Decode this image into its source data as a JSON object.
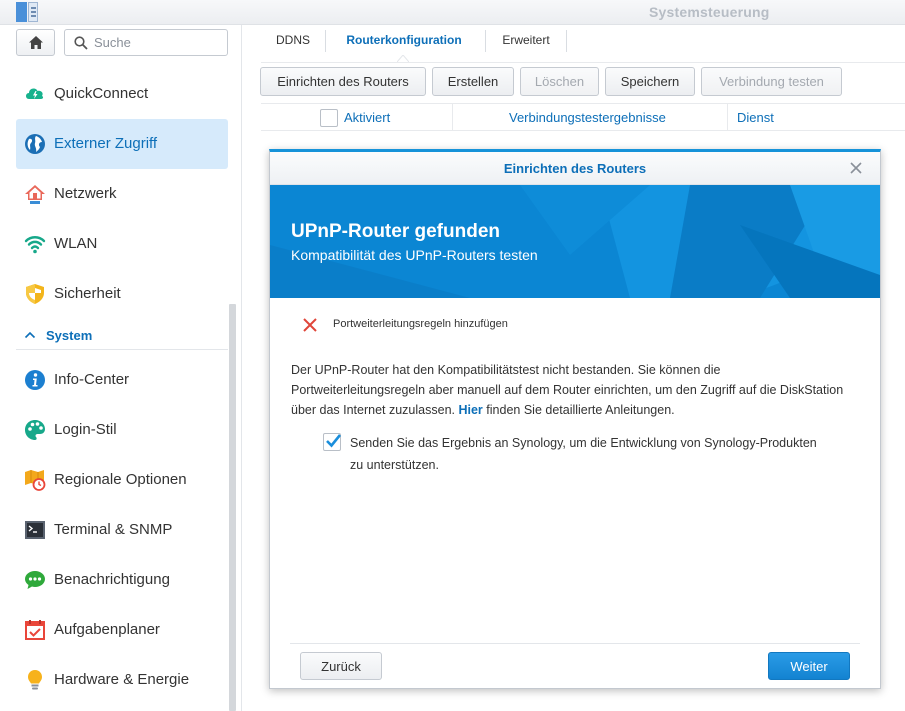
{
  "window": {
    "title": "Systemsteuerung"
  },
  "colors": {
    "accent": "#0d6fb8",
    "banner": "#0b86d3",
    "active_nav_bg": "#d6eafb",
    "primary_button": "#1a8edb",
    "error": "#e0463a"
  },
  "sidebar": {
    "search_placeholder": "Suche",
    "items": [
      {
        "label": "QuickConnect",
        "icon": "quickconnect-icon"
      },
      {
        "label": "Externer Zugriff",
        "icon": "globe-icon",
        "active": true
      },
      {
        "label": "Netzwerk",
        "icon": "network-house-icon"
      },
      {
        "label": "WLAN",
        "icon": "wifi-icon"
      },
      {
        "label": "Sicherheit",
        "icon": "shield-icon"
      }
    ],
    "section_label": "System",
    "system_items": [
      {
        "label": "Info-Center",
        "icon": "info-icon"
      },
      {
        "label": "Login-Stil",
        "icon": "palette-icon"
      },
      {
        "label": "Regionale Optionen",
        "icon": "map-clock-icon"
      },
      {
        "label": "Terminal & SNMP",
        "icon": "terminal-icon"
      },
      {
        "label": "Benachrichtigung",
        "icon": "chat-bubble-icon"
      },
      {
        "label": "Aufgabenplaner",
        "icon": "calendar-check-icon"
      },
      {
        "label": "Hardware & Energie",
        "icon": "lightbulb-icon"
      }
    ]
  },
  "tabs": [
    "DDNS",
    "Routerkonfiguration",
    "Erweitert"
  ],
  "active_tab": "Routerkonfiguration",
  "toolbar": {
    "setup": "Einrichten des Routers",
    "create": "Erstellen",
    "delete": "Löschen",
    "save": "Speichern",
    "test": "Verbindung testen"
  },
  "table": {
    "columns": [
      "Aktiviert",
      "Verbindungstestergebnisse",
      "Dienst"
    ]
  },
  "dialog": {
    "title": "Einrichten des Routers",
    "banner_title": "UPnP-Router gefunden",
    "banner_subtitle": "Kompatibilität des UPnP-Routers testen",
    "status_item": "Portweiterleitungsregeln hinzufügen",
    "message_before_link": "Der UPnP-Router hat den Kompatibilitätstest nicht bestanden. Sie können die Portweiterleitungsregeln aber manuell auf dem Router einrichten, um den Zugriff auf die DiskStation über das Internet zuzulassen.",
    "link_text": "Hier",
    "message_after_link": "finden Sie detaillierte Anleitungen.",
    "send_result_label": "Senden Sie das Ergebnis an Synology, um die Entwicklung von Synology-Produkten zu unterstützen.",
    "send_result_checked": true,
    "back_button": "Zurück",
    "next_button": "Weiter"
  }
}
